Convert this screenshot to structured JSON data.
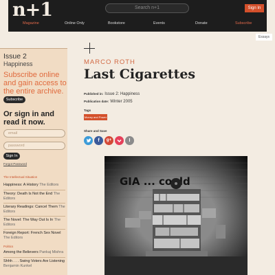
{
  "header": {
    "logo": "n+1",
    "search_placeholder": "Search n+1",
    "signin_label": "Sign In",
    "nav": [
      {
        "label": "Magazine",
        "active": true
      },
      {
        "label": "Online Only",
        "active": false
      },
      {
        "label": "Bookstore",
        "active": false
      },
      {
        "label": "Events",
        "active": false
      },
      {
        "label": "Donate",
        "active": false
      },
      {
        "label": "Subscribe",
        "active": true
      }
    ]
  },
  "section_tag": "Essays",
  "sidebar": {
    "issue": "Issue 2",
    "issue_name": "Happiness",
    "subscribe_text": "Subscribe online and gain access to the entire archive.",
    "subscribe_button": "Subscribe",
    "signin_prompt": "Or sign in and read it now.",
    "email_placeholder": "email",
    "password_placeholder": "password",
    "signin_button": "Sign In",
    "forgot_password": "Forgot Password",
    "sections": [
      {
        "name": "The Intellectual Situation",
        "articles": [
          {
            "title": "Happiness: A History",
            "author": "The Editors"
          },
          {
            "title": "Theory: Death Is Not the End",
            "author": "The Editors"
          },
          {
            "title": "Literary Readings: Cancel Them",
            "author": "The Editors"
          },
          {
            "title": "The Novel: The Way Out Is In",
            "author": "The Editors"
          },
          {
            "title": "Foreign Report: French Sex Novel",
            "author": "The Editors"
          }
        ]
      },
      {
        "name": "Politics",
        "articles": [
          {
            "title": "Among the Believers",
            "author": "Pankaj Mishra"
          },
          {
            "title": "Shhh . . . Swing Voters Are Listening",
            "author": "Benjamin Kunkel"
          }
        ]
      }
    ]
  },
  "article": {
    "author": "MARCO ROTH",
    "title": "Last Cigarettes",
    "published_in_label": "Published in:",
    "published_in": "Issue 2: Happiness",
    "publication_date_label": "Publication date:",
    "publication_date": "Winter 2005",
    "tags_label": "Tags",
    "tags": [
      "Money and Power"
    ],
    "share_label": "Share and Save",
    "share_icons": [
      {
        "name": "twitter-icon",
        "glyph": "t",
        "color": "#3b9bd8"
      },
      {
        "name": "facebook-icon",
        "glyph": "f",
        "color": "#3b5a9a"
      },
      {
        "name": "google-plus-icon",
        "glyph": "g+",
        "color": "#d34836"
      },
      {
        "name": "pocket-icon",
        "glyph": "⌄",
        "color": "#e6405a"
      },
      {
        "name": "instapaper-icon",
        "glyph": "I",
        "color": "#8b8b8b"
      }
    ],
    "photo_graffiti": "GIA ... could"
  }
}
